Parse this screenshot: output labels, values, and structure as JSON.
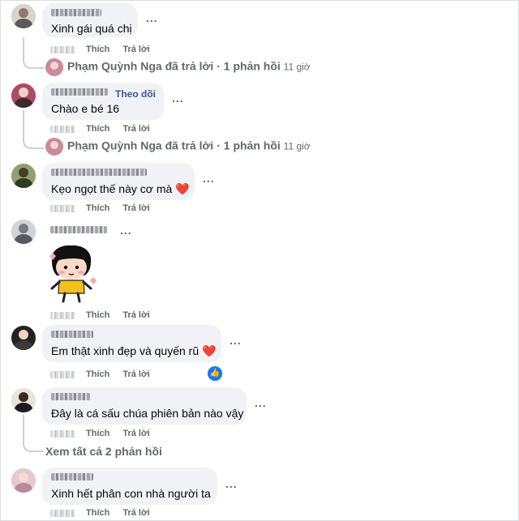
{
  "comments": [
    {
      "text": "Xinh gái quá chị",
      "actions": {
        "like": "Thích",
        "reply": "Trả lời"
      },
      "more": "...",
      "reply_summary": {
        "author": "Phạm Quỳnh Nga",
        "verb": "đã trả lời",
        "separator": "·",
        "count": "1 phản hồi",
        "time": "11 giờ"
      }
    },
    {
      "text": "Chào e bé 16",
      "follow": "Theo dõi",
      "actions": {
        "like": "Thích",
        "reply": "Trả lời"
      },
      "more": "...",
      "reply_summary": {
        "author": "Phạm Quỳnh Nga",
        "verb": "đã trả lời",
        "separator": "·",
        "count": "1 phản hồi",
        "time": "11 giờ"
      }
    },
    {
      "text": "Kẹo ngọt thế này cơ mà ❤️",
      "actions": {
        "like": "Thích",
        "reply": "Trả lời"
      },
      "more": "..."
    },
    {
      "text": "",
      "sticker": "cartoon-girl-sticker",
      "actions": {
        "like": "Thích",
        "reply": "Trả lời"
      },
      "more": "..."
    },
    {
      "text": "Em thật xinh đẹp và quyến rũ ❤️",
      "actions": {
        "like": "Thích",
        "reply": "Trả lời"
      },
      "more": "...",
      "reaction": "like-icon"
    },
    {
      "text": "Đây là cá sấu chúa phiên bản nào vậy",
      "actions": {
        "like": "Thích",
        "reply": "Trả lời"
      },
      "more": "...",
      "view_replies": "Xem tất cả 2 phản hồi"
    },
    {
      "text": "Xinh hết phân con nhà người ta",
      "actions": {
        "like": "Thích",
        "reply": "Trả lời"
      },
      "more": "..."
    }
  ],
  "colors": {
    "bubble": "#f0f2f5",
    "link": "#385898",
    "meta": "#65676b",
    "like": "#1877f2"
  }
}
